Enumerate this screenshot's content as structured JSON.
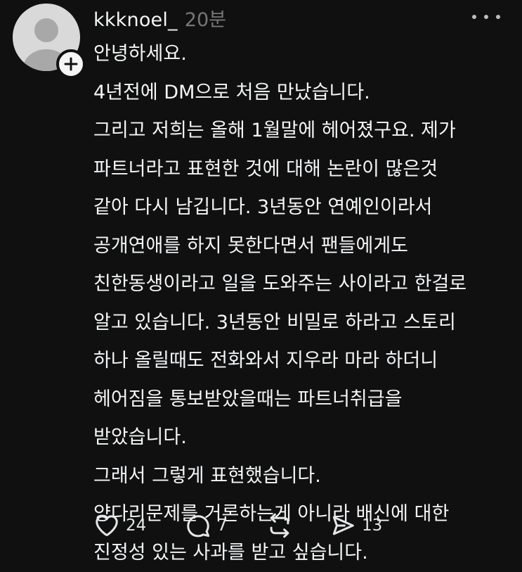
{
  "post": {
    "username": "kkknoel_",
    "time": "20분",
    "lines": [
      "안녕하세요.",
      "4년전에 DM으로 처음 만났습니다.",
      "그리고 저희는 올해 1월말에 헤어졌구요. 제가",
      "파트너라고 표현한 것에 대해 논란이 많은것",
      "같아 다시 남깁니다. 3년동안 연예인이라서",
      "공개연애를 하지 못한다면서 팬들에게도",
      "친한동생이라고 일을 도와주는 사이라고 한걸로",
      "알고 있습니다. 3년동안 비밀로 하라고 스토리",
      "하나 올릴때도 전화와서 지우라 마라 하더니",
      "헤어짐을 통보받았을때는 파트너취급을",
      "받았습니다.",
      "그래서 그렇게 표현했습니다.",
      "양다리문제를 거론하는게 아니라 배신에 대한",
      "진정성 있는 사과를 받고 싶습니다."
    ],
    "actions": {
      "likes": "24",
      "replies": "7",
      "shares": "13"
    }
  },
  "icons": {
    "avatar": "default-avatar-icon",
    "follow": "plus-icon",
    "more": "more-horizontal-icon",
    "like": "heart-icon",
    "reply": "comment-bubble-icon",
    "repost": "repost-icon",
    "share": "send-icon"
  },
  "colors": {
    "background": "#101010",
    "text": "#f3f5f7",
    "muted": "#777777"
  }
}
